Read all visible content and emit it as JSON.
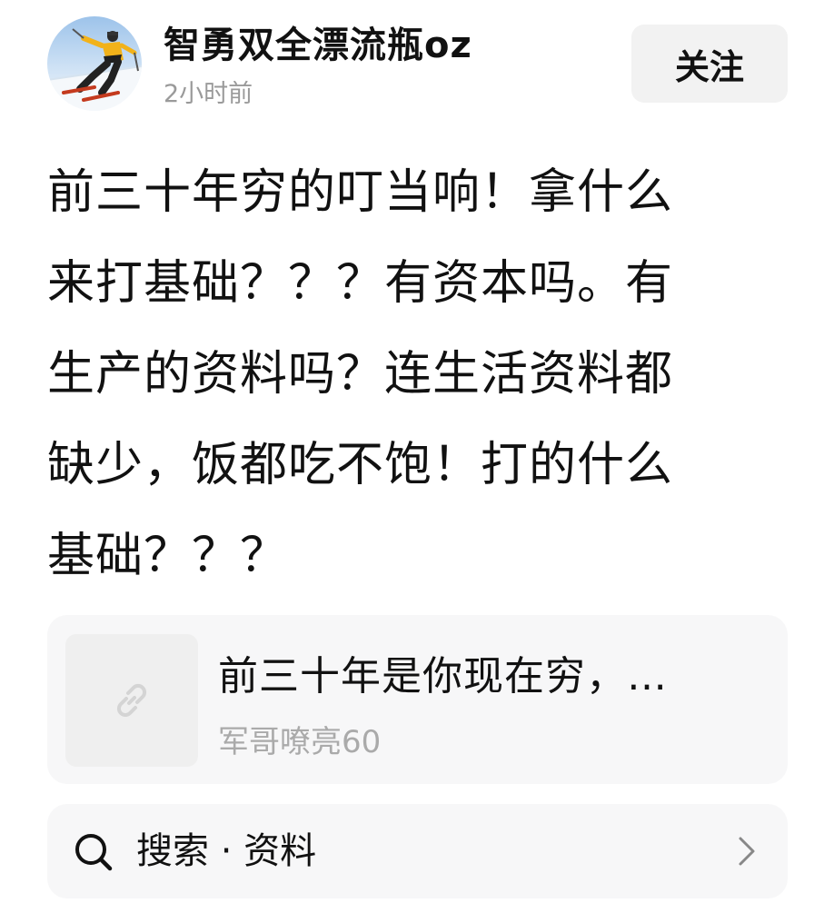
{
  "header": {
    "username": "智勇双全漂流瓶oz",
    "timestamp": "2小时前",
    "follow_label": "关注"
  },
  "post": {
    "lines": [
      "前三十年穷的叮当响！拿什么",
      "来打基础？？？有资本吗。有",
      "生产的资料吗？连生活资料都",
      "缺少，饭都吃不饱！打的什么",
      "基础？？？"
    ]
  },
  "link_card": {
    "thumbnail_icon": "link-icon",
    "title": "前三十年是你现在穷，…",
    "author": "军哥嘹亮60"
  },
  "search": {
    "icon": "search-icon",
    "text": "搜索 · 资料",
    "chevron_icon": "chevron-right-icon"
  }
}
